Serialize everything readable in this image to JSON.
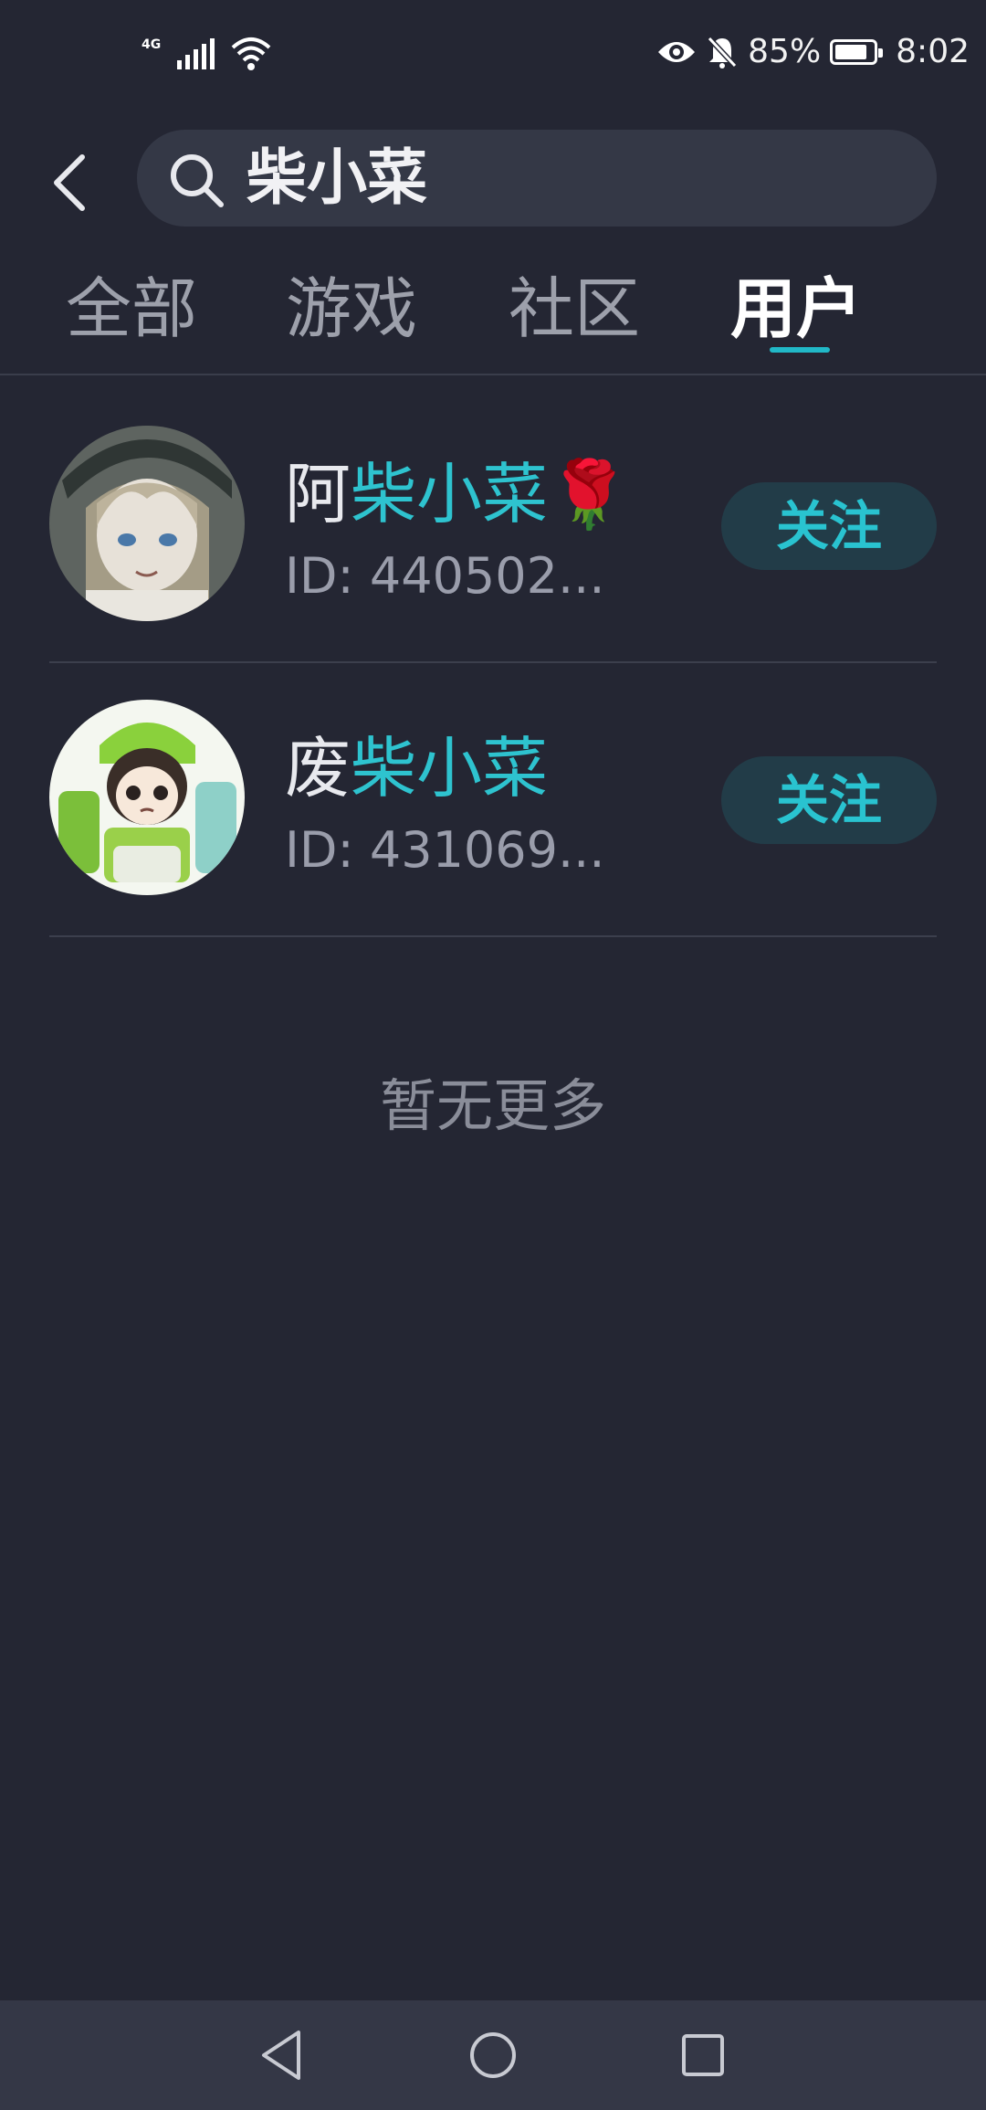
{
  "status_bar": {
    "network": "4G",
    "battery": "85%",
    "battery_level": 0.85,
    "time": "8:02"
  },
  "search": {
    "query": "柴小菜"
  },
  "tabs": [
    {
      "label": "全部",
      "active": false
    },
    {
      "label": "游戏",
      "active": false
    },
    {
      "label": "社区",
      "active": false
    },
    {
      "label": "用户",
      "active": true
    }
  ],
  "users": [
    {
      "name_prefix": "阿",
      "name_highlight": "柴小菜",
      "name_suffix": "🌹",
      "id": "ID: 440502...",
      "follow_label": "关注"
    },
    {
      "name_prefix": "废",
      "name_highlight": "柴小菜",
      "name_suffix": "",
      "id": "ID: 431069...",
      "follow_label": "关注"
    }
  ],
  "no_more_text": "暂无更多",
  "colors": {
    "background": "#242633",
    "accent": "#2ec3cf",
    "follow_bg": "#223c48"
  }
}
